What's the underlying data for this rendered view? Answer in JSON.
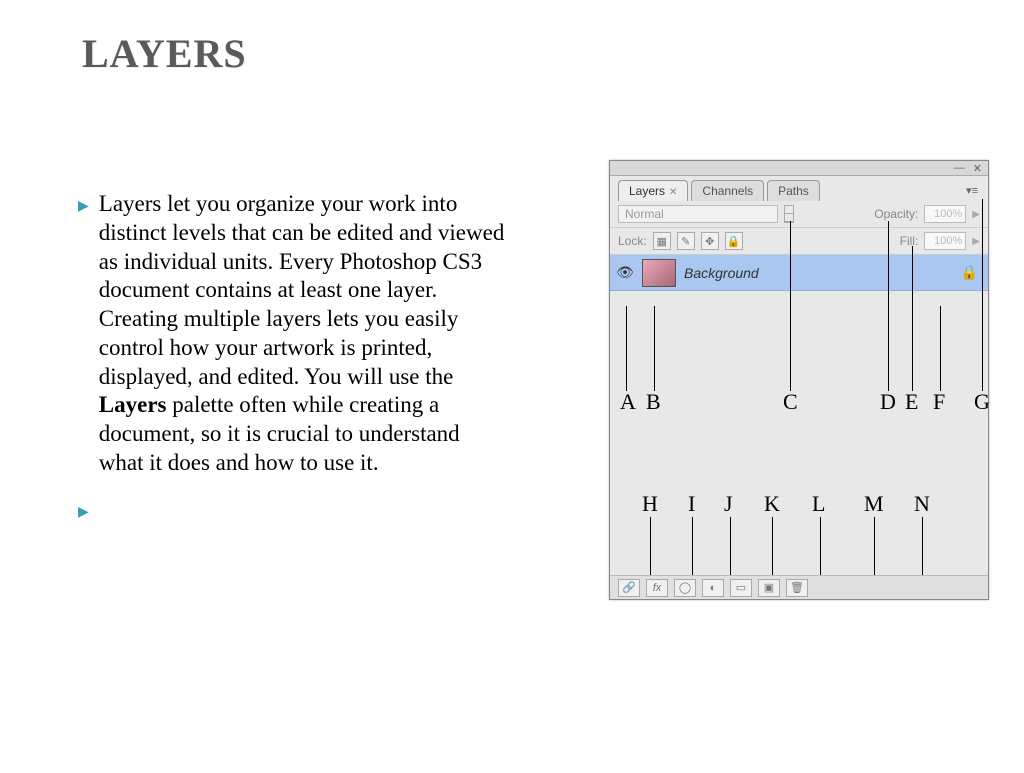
{
  "title": "LAYERS",
  "body_before": "Layers let you organize your work into distinct levels that can be edited and viewed as individual units. Every Photoshop CS3 document contains at least one layer. Creating multiple layers lets you easily control how your artwork is printed, displayed, and edited. You will use the ",
  "body_bold": "Layers",
  "body_after": " palette often while creating a document, so it is crucial to understand what it does and how to use it.",
  "panel": {
    "tabs": {
      "layers": "Layers",
      "channels": "Channels",
      "paths": "Paths"
    },
    "blend": "Normal",
    "opacity_label": "Opacity:",
    "opacity_value": "100%",
    "lock_label": "Lock:",
    "fill_label": "Fill:",
    "fill_value": "100%",
    "layer_name": "Background"
  },
  "labels_top": {
    "A": "A",
    "B": "B",
    "C": "C",
    "D": "D",
    "E": "E",
    "F": "F",
    "G": "G"
  },
  "labels_bot": {
    "H": "H",
    "I": "I",
    "J": "J",
    "K": "K",
    "L": "L",
    "M": "M",
    "N": "N"
  }
}
